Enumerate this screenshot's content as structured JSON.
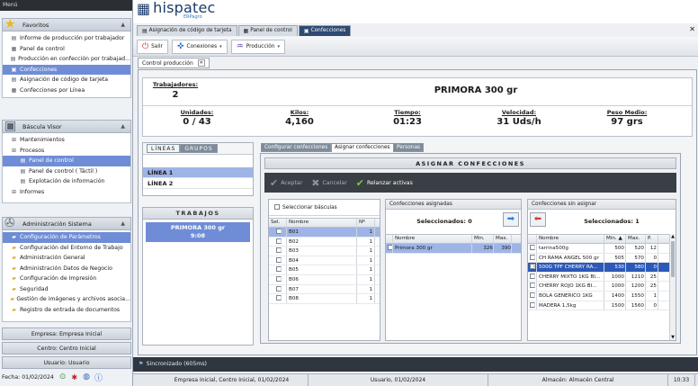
{
  "sidebar": {
    "topbar": "Menú",
    "favoritos": {
      "title": "Favoritos",
      "items": [
        "Informe de producción por trabajador",
        "Panel de control",
        "Producción en confección por trabajad...",
        "Confecciones",
        "Asignación de código de tarjeta",
        "Confecciones por Línea"
      ],
      "selected_index": 3
    },
    "bascula": {
      "title": "Báscula Visor",
      "items": [
        {
          "label": "Mantenimientos",
          "level": 0
        },
        {
          "label": "Procesos",
          "level": 0
        },
        {
          "label": "Panel de control",
          "level": 1
        },
        {
          "label": "Panel de control ( Táctil )",
          "level": 1
        },
        {
          "label": "Explotación de información",
          "level": 1
        },
        {
          "label": "Informes",
          "level": 0
        }
      ],
      "selected_index": 2
    },
    "admin": {
      "title": "Administración Sistema",
      "items": [
        "Configuración de Parámetros",
        "Configuración del Entorno de Trabajo",
        "Administración General",
        "Administración Datos de Negocio",
        "Configuración de Impresión",
        "Seguridad",
        "Gestión de imágenes y archivos asocia...",
        "Registro de entrada de documentos"
      ],
      "selected_index": 0
    },
    "empresa": "Empresa: Empresa Inicial",
    "centro": "Centro: Centro Inicial",
    "usuario": "Usuario: Usuario",
    "fecha": "Fecha: 01/02/2024"
  },
  "brand": {
    "name": "hispatec",
    "sub": "ERPagro"
  },
  "tabs": [
    "Asignación de código de tarjeta",
    "Panel de control",
    "Confecciones"
  ],
  "active_tab_index": 2,
  "toolbar": {
    "salir": "Salir",
    "conexiones": "Conexiones",
    "produccion": "Producción"
  },
  "subtab": "Control producción",
  "stats": {
    "trabajadores_label": "Trabajadores:",
    "trabajadores_value": "2",
    "title": "PRIMORA 300 gr",
    "unidades_label": "Unidades:",
    "unidades_value": "0 / 43",
    "kilos_label": "Kilos:",
    "kilos_value": "4,160",
    "tiempo_label": "Tiempo:",
    "tiempo_value": "01:23",
    "velocidad_label": "Velocidad:",
    "velocidad_value": "31 Uds/h",
    "peso_label": "Peso Medio:",
    "peso_value": "97 grs"
  },
  "lineas": {
    "tab1": "LÍNEAS",
    "tab2": "GRUPOS",
    "items": [
      "LÍNEA 1",
      "LÍNEA 2"
    ]
  },
  "trabajos": {
    "title": "TRABAJOS",
    "item_line1": "PRIMORA 300 gr",
    "item_line2": "9:08"
  },
  "inner_tabs": [
    "Configurar confecciones",
    "Asignar confecciones",
    "Personas"
  ],
  "asignar": {
    "title": "ASIGNAR CONFECCIONES",
    "aceptar": "Aceptar",
    "cancelar": "Cancelar",
    "relanzar": "Relanzar activas",
    "basculas": {
      "select_all": "Seleccionar básculas",
      "headers": [
        "Sel.",
        "Nombre",
        "Nº"
      ],
      "rows": [
        {
          "nombre": "B01",
          "n": "1"
        },
        {
          "nombre": "B02",
          "n": "1"
        },
        {
          "nombre": "B03",
          "n": "1"
        },
        {
          "nombre": "B04",
          "n": "1"
        },
        {
          "nombre": "B05",
          "n": "1"
        },
        {
          "nombre": "B06",
          "n": "1"
        },
        {
          "nombre": "B07",
          "n": "1"
        },
        {
          "nombre": "B08",
          "n": "1"
        }
      ]
    },
    "asignadas": {
      "title": "Confecciones asignadas",
      "count": "Seleccionados: 0",
      "headers": [
        "Nombre",
        "Min.",
        "Max."
      ],
      "rows": [
        {
          "nombre": "Primora 300 gr",
          "min": "326",
          "max": "390"
        }
      ]
    },
    "sin_asignar": {
      "title": "Confecciones sin asignar",
      "count": "Seleccionados: 1",
      "headers": [
        "Nombre",
        "Min. ▲",
        "Max.",
        "P."
      ],
      "rows": [
        {
          "nombre": "tarrina500g",
          "min": "500",
          "max": "520",
          "p": "12"
        },
        {
          "nombre": "CH RAMA ANGEL 500 gr",
          "min": "505",
          "max": "570",
          "p": "0"
        },
        {
          "nombre": "500G TPF CHERRY RA...",
          "min": "530",
          "max": "580",
          "p": "0"
        },
        {
          "nombre": "CHERRY MIXTO 1KG BI...",
          "min": "1000",
          "max": "1210",
          "p": "25"
        },
        {
          "nombre": "CHERRY ROJO 1KG BI...",
          "min": "1000",
          "max": "1200",
          "p": "25"
        },
        {
          "nombre": "BOLA GENERICO 1KG",
          "min": "1400",
          "max": "1550",
          "p": "1"
        },
        {
          "nombre": "MADERA 1,5kg",
          "min": "1500",
          "max": "1560",
          "p": "0"
        }
      ],
      "selected_index": 2
    }
  },
  "sync": "Sincronizado (605ms)",
  "status": [
    "Empresa Inicial, Centro Inicial, 01/02/2024",
    "Usuario, 01/02/2024",
    "Almacén: Almacén Central",
    "10:33"
  ]
}
